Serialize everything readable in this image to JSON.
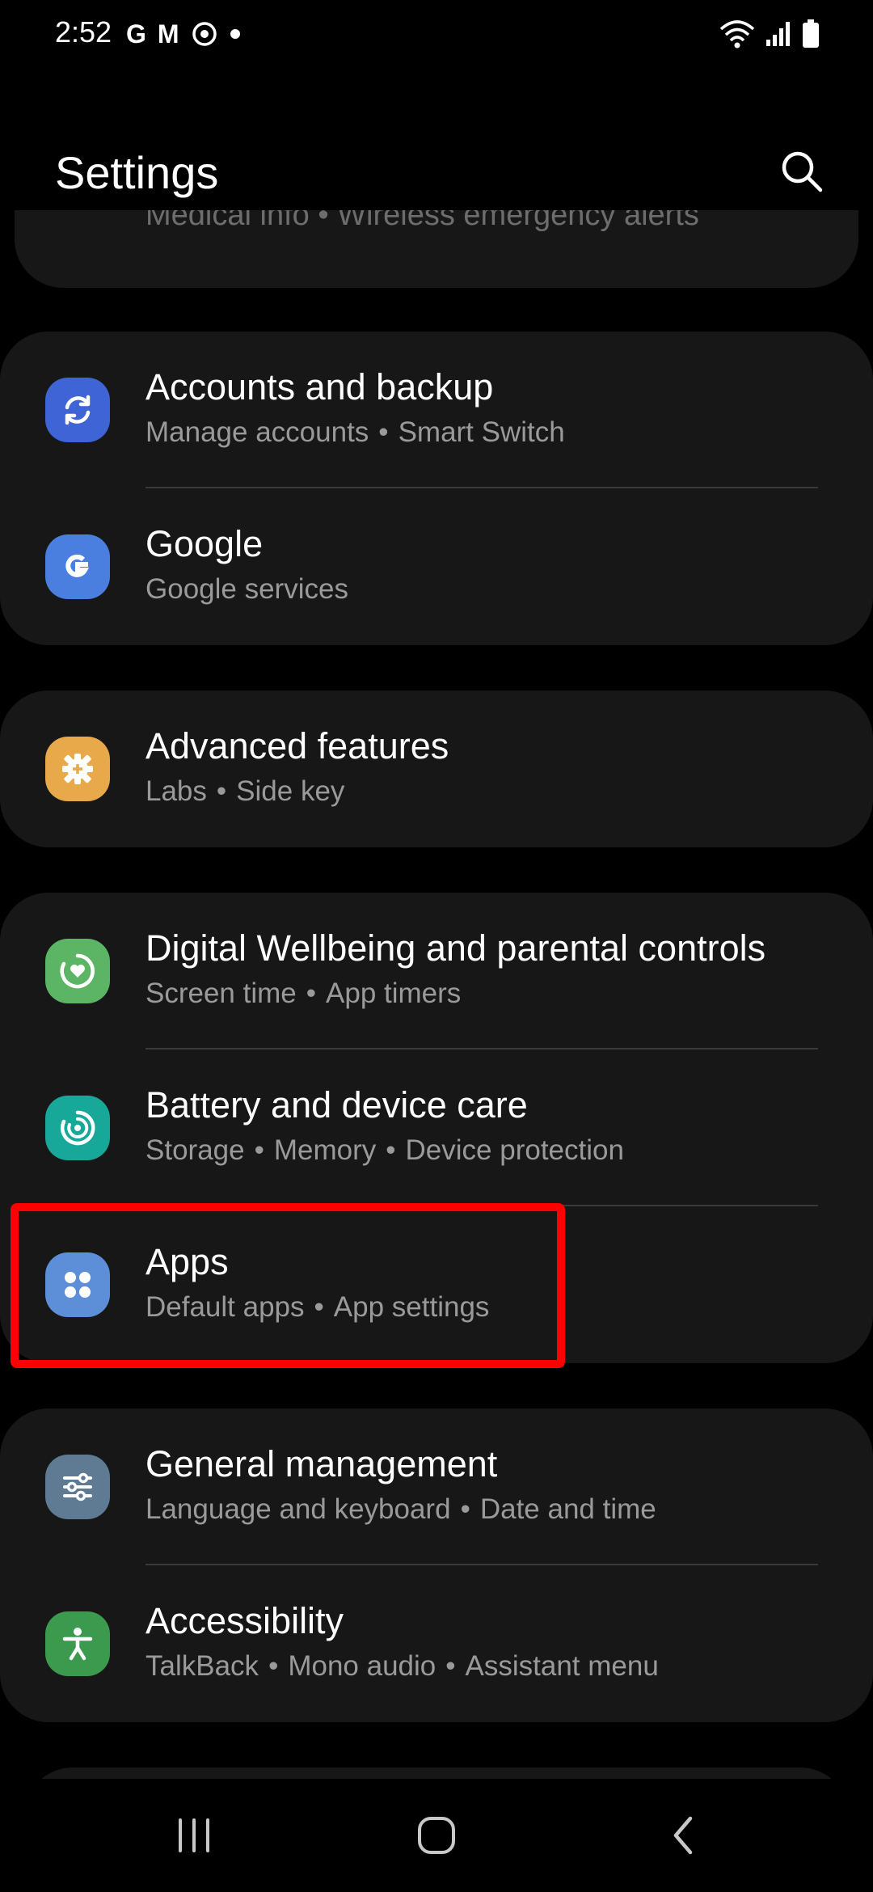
{
  "status_bar": {
    "time": "2:52",
    "notification_icons": [
      "G",
      "M"
    ],
    "icons": [
      "google-icon",
      "gmail-icon",
      "sync-icon",
      "dot-icon",
      "wifi-icon",
      "signal-icon",
      "battery-icon"
    ]
  },
  "header": {
    "title": "Settings",
    "search_icon": "search-icon"
  },
  "peek_card": {
    "subtitle": "Medical info  •  Wireless emergency alerts"
  },
  "groups": [
    {
      "items": [
        {
          "title": "Accounts and backup",
          "subtitle": [
            "Manage accounts",
            "Smart Switch"
          ],
          "icon": "sync-icon",
          "icon_color": "#3e64d6"
        },
        {
          "title": "Google",
          "subtitle": [
            "Google services"
          ],
          "icon": "google-icon",
          "icon_color": "#4a7fe0"
        }
      ]
    },
    {
      "items": [
        {
          "title": "Advanced features",
          "subtitle": [
            "Labs",
            "Side key"
          ],
          "icon": "gear-plus-icon",
          "icon_color": "#e8a94a"
        }
      ]
    },
    {
      "items": [
        {
          "title": "Digital Wellbeing and parental controls",
          "subtitle": [
            "Screen time",
            "App timers"
          ],
          "icon": "heart-circle-icon",
          "icon_color": "#5bb565"
        },
        {
          "title": "Battery and device care",
          "subtitle": [
            "Storage",
            "Memory",
            "Device protection"
          ],
          "icon": "device-care-icon",
          "icon_color": "#17a89a"
        },
        {
          "title": "Apps",
          "subtitle": [
            "Default apps",
            "App settings"
          ],
          "icon": "apps-grid-icon",
          "icon_color": "#5d8fd8"
        }
      ]
    },
    {
      "items": [
        {
          "title": "General management",
          "subtitle": [
            "Language and keyboard",
            "Date and time"
          ],
          "icon": "sliders-icon",
          "icon_color": "#5f7a93"
        },
        {
          "title": "Accessibility",
          "subtitle": [
            "TalkBack",
            "Mono audio",
            "Assistant menu"
          ],
          "icon": "accessibility-icon",
          "icon_color": "#3c9a4f"
        }
      ]
    }
  ],
  "nav_bar": {
    "icons": [
      "recents-icon",
      "home-icon",
      "back-icon"
    ]
  },
  "colors": {
    "background": "#000000",
    "card": "#171717",
    "highlight": "#ff0000",
    "subtitle": "#9a9a9a"
  }
}
